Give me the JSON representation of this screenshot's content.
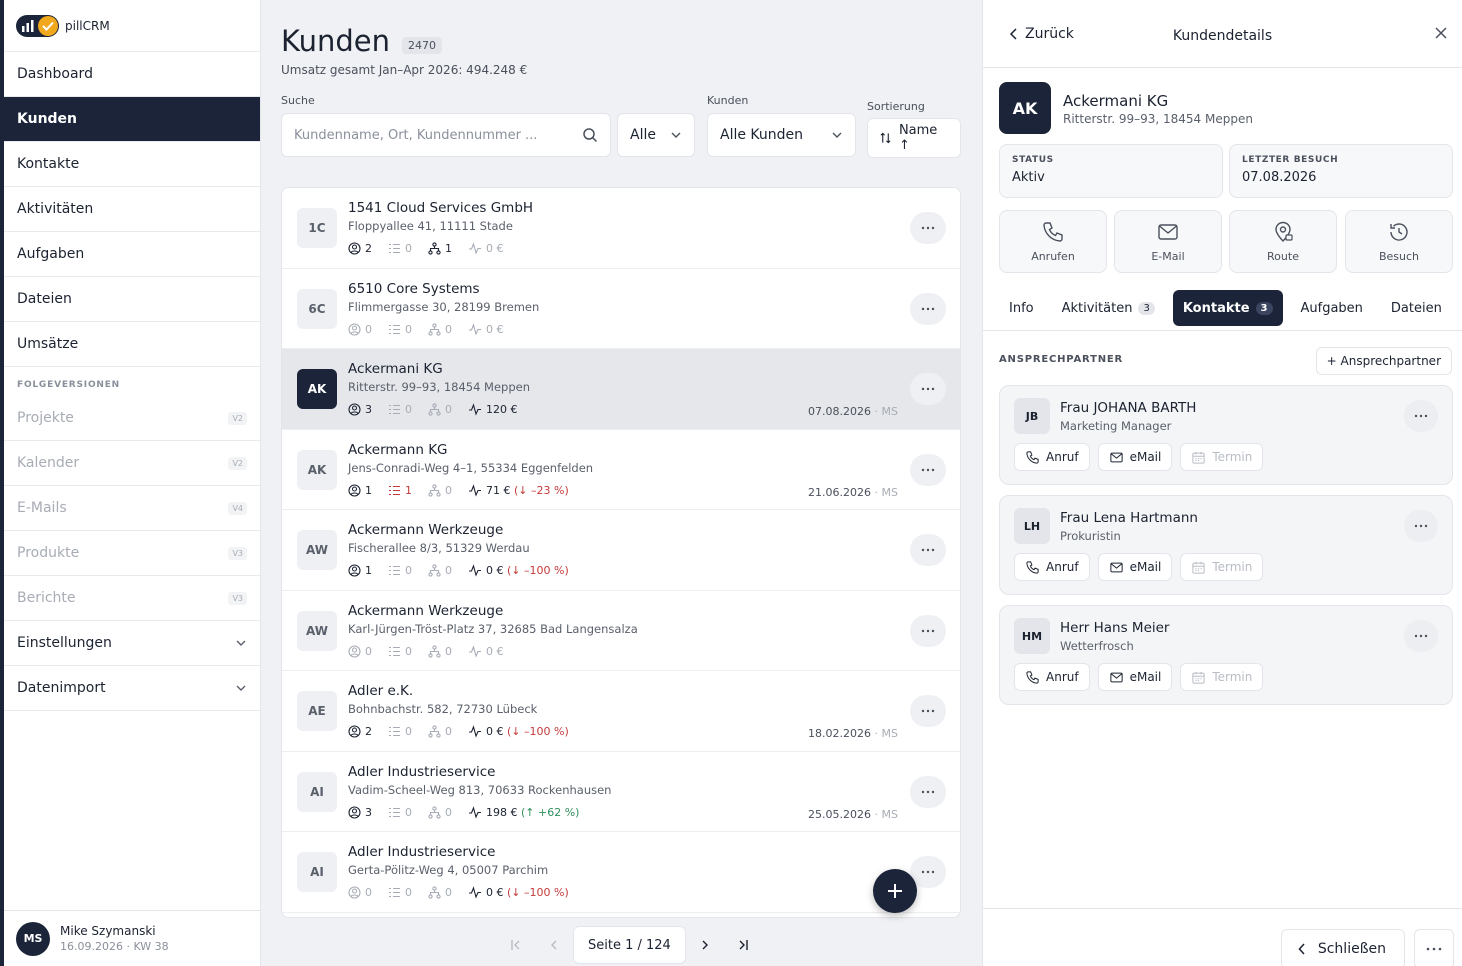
{
  "app": {
    "name": "pillCRM"
  },
  "nav": {
    "items": [
      {
        "label": "Dashboard"
      },
      {
        "label": "Kunden"
      },
      {
        "label": "Kontakte"
      },
      {
        "label": "Aktivitäten"
      },
      {
        "label": "Aufgaben"
      },
      {
        "label": "Dateien"
      },
      {
        "label": "Umsätze"
      }
    ],
    "section_label": "FOLGEVERSIONEN",
    "future": [
      {
        "label": "Projekte",
        "badge": "V2"
      },
      {
        "label": "Kalender",
        "badge": "V2"
      },
      {
        "label": "E-Mails",
        "badge": "V4"
      },
      {
        "label": "Produkte",
        "badge": "V3"
      },
      {
        "label": "Berichte",
        "badge": "V3"
      }
    ],
    "bottom": [
      {
        "label": "Einstellungen"
      },
      {
        "label": "Datenimport"
      }
    ]
  },
  "user": {
    "initials": "MS",
    "name": "Mike Szymanski",
    "sub": "16.09.2026 · KW 38"
  },
  "page": {
    "title": "Kunden",
    "count": "2470",
    "subtitle": "Umsatz gesamt Jan–Apr 2026: 494.248 €"
  },
  "filters": {
    "search_label": "Suche",
    "search_placeholder": "Kundenname, Ort, Kundennummer ...",
    "scope_value": "Alle",
    "kunden_label": "Kunden",
    "kunden_value": "Alle Kunden",
    "sort_label": "Sortierung",
    "sort_value": "Name ↑"
  },
  "customers": [
    {
      "initials": "1C",
      "name": "1541 Cloud Services GmbH",
      "address": "Floppyallee 41, 11111 Stade",
      "contacts": "2",
      "tasks": "0",
      "branches": "1",
      "revenue": "0 €",
      "change": "",
      "date": "",
      "ms": ""
    },
    {
      "initials": "6C",
      "name": "6510 Core Systems",
      "address": "Flimmergasse 30, 28199 Bremen",
      "contacts": "0",
      "tasks": "0",
      "branches": "0",
      "revenue": "0 €",
      "change": "",
      "date": "",
      "ms": ""
    },
    {
      "initials": "AK",
      "name": "Ackermani KG",
      "address": "Ritterstr. 99–93, 18454 Meppen",
      "contacts": "3",
      "tasks": "0",
      "branches": "0",
      "revenue": "120 €",
      "change": "",
      "date": "07.08.2026",
      "ms": " · MS"
    },
    {
      "initials": "AK",
      "name": "Ackermann KG",
      "address": "Jens-Conradi-Weg 4–1, 55334 Eggenfelden",
      "contacts": "1",
      "tasks": "1",
      "branches": "0",
      "revenue": "71 €",
      "change": "(↓ –23 %)",
      "date": "21.06.2026",
      "ms": " · MS"
    },
    {
      "initials": "AW",
      "name": "Ackermann Werkzeuge",
      "address": "Fischerallee 8/3, 51329 Werdau",
      "contacts": "1",
      "tasks": "0",
      "branches": "0",
      "revenue": "0 €",
      "change": "(↓ –100 %)",
      "date": "",
      "ms": ""
    },
    {
      "initials": "AW",
      "name": "Ackermann Werkzeuge",
      "address": "Karl-Jürgen-Tröst-Platz 37, 32685 Bad Langensalza",
      "contacts": "0",
      "tasks": "0",
      "branches": "0",
      "revenue": "0 €",
      "change": "",
      "date": "",
      "ms": ""
    },
    {
      "initials": "AE",
      "name": "Adler e.K.",
      "address": "Bohnbachstr. 582, 72730 Lübeck",
      "contacts": "2",
      "tasks": "0",
      "branches": "0",
      "revenue": "0 €",
      "change": "(↓ –100 %)",
      "date": "18.02.2026",
      "ms": " · MS"
    },
    {
      "initials": "AI",
      "name": "Adler Industrieservice",
      "address": "Vadim-Scheel-Weg 813, 70633 Rockenhausen",
      "contacts": "3",
      "tasks": "0",
      "branches": "0",
      "revenue": "198 €",
      "change": "(↑ +62 %)",
      "date": "25.05.2026",
      "ms": " · MS"
    },
    {
      "initials": "AI",
      "name": "Adler Industrieservice",
      "address": "Gerta-Pölitz-Weg 4, 05007 Parchim",
      "contacts": "0",
      "tasks": "0",
      "branches": "0",
      "revenue": "0 €",
      "change": "(↓ –100 %)",
      "date": "",
      "ms": ""
    }
  ],
  "pagination": {
    "label": "Seite 1 / 124"
  },
  "panel": {
    "back_label": "Zurück",
    "title": "Kundendetails",
    "customer": {
      "initials": "AK",
      "name": "Ackermani KG",
      "address": "Ritterstr. 99–93, 18454 Meppen"
    },
    "status": {
      "label": "STATUS",
      "value": "Aktiv"
    },
    "last_visit": {
      "label": "LETZTER BESUCH",
      "value": "07.08.2026"
    },
    "actions": [
      {
        "label": "Anrufen"
      },
      {
        "label": "E-Mail"
      },
      {
        "label": "Route"
      },
      {
        "label": "Besuch"
      }
    ],
    "tabs": [
      {
        "label": "Info",
        "count": ""
      },
      {
        "label": "Aktivitäten",
        "count": "3"
      },
      {
        "label": "Kontakte",
        "count": "3"
      },
      {
        "label": "Aufgaben",
        "count": ""
      },
      {
        "label": "Dateien",
        "count": ""
      }
    ],
    "section_label": "ANSPRECHPARTNER",
    "add_label": "+ Ansprechpartner",
    "contacts": [
      {
        "initials": "JB",
        "name": "Frau JOHANA BARTH",
        "role": "Marketing Manager"
      },
      {
        "initials": "LH",
        "name": "Frau Lena Hartmann",
        "role": "Prokuristin"
      },
      {
        "initials": "HM",
        "name": "Herr Hans Meier",
        "role": "Wetterfrosch"
      }
    ],
    "contact_buttons": {
      "call": "Anruf",
      "mail": "eMail",
      "meeting": "Termin"
    },
    "close_label": "Schließen"
  },
  "colors": {
    "primary": "#1b2438",
    "accent": "#f2a81d",
    "negative": "#c43a3a",
    "positive": "#2f8f5b"
  }
}
